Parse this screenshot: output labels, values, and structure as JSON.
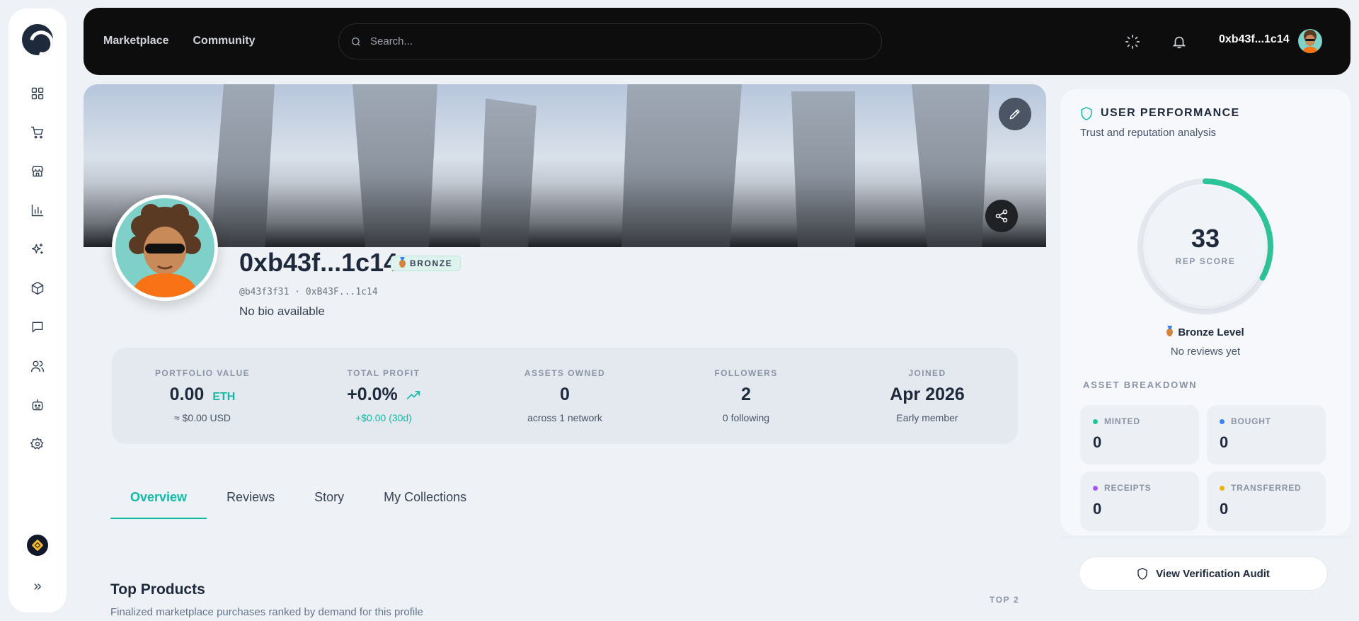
{
  "header": {
    "nav": [
      {
        "label": "Marketplace"
      },
      {
        "label": "Community"
      }
    ],
    "search_placeholder": "Search...",
    "wallet": "0xb43f...1c14"
  },
  "profile": {
    "name": "0xb43f...1c14",
    "tier_badge": "BRONZE",
    "handle": "@b43f3f31 · 0xB43F...1c14",
    "bio": "No bio available"
  },
  "stats": [
    {
      "label": "PORTFOLIO VALUE",
      "value": "0.00",
      "unit": "ETH",
      "sub": "≈ $0.00 USD"
    },
    {
      "label": "TOTAL PROFIT",
      "value": "+0.0%",
      "sub": "+$0.00 (30d)"
    },
    {
      "label": "ASSETS OWNED",
      "value": "0",
      "sub": "across 1 network"
    },
    {
      "label": "FOLLOWERS",
      "value": "2",
      "sub": "0 following"
    },
    {
      "label": "JOINED",
      "value": "Apr 2026",
      "sub": "Early member"
    }
  ],
  "tabs": [
    {
      "label": "Overview"
    },
    {
      "label": "Reviews"
    },
    {
      "label": "Story"
    },
    {
      "label": "My Collections"
    }
  ],
  "top_products": {
    "title": "Top Products",
    "subtitle": "Finalized marketplace purchases ranked by demand for this profile",
    "count_label": "TOP 2"
  },
  "performance": {
    "title": "USER PERFORMANCE",
    "subtitle": "Trust and reputation analysis",
    "score": "33",
    "score_value": 33,
    "score_max": 100,
    "score_label": "REP SCORE",
    "level": "Bronze Level",
    "reviews": "No reviews yet",
    "breakdown_title": "ASSET BREAKDOWN",
    "breakdown": [
      {
        "label": "MINTED",
        "value": "0",
        "color": "#22c59a"
      },
      {
        "label": "BOUGHT",
        "value": "0",
        "color": "#3b82f6"
      },
      {
        "label": "RECEIPTS",
        "value": "0",
        "color": "#a855f7"
      },
      {
        "label": "TRANSFERRED",
        "value": "0",
        "color": "#eab308"
      }
    ],
    "audit_label": "View Verification Audit"
  },
  "colors": {
    "accent": "#14b8a6",
    "gauge": "#2ec49a"
  }
}
